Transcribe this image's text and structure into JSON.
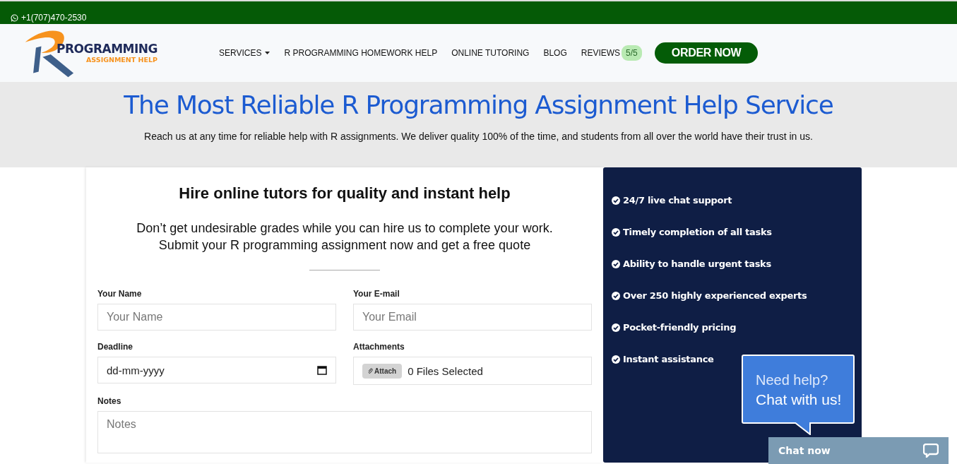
{
  "top_bar": {
    "phone": "+1(707)470-2530"
  },
  "logo": {
    "title": "PROGRAMMING",
    "subtitle": "ASSIGNMENT HELP"
  },
  "nav": {
    "items": [
      {
        "label": "SERVICES",
        "kind": "dropdown"
      },
      {
        "label": "R PROGRAMMING HOMEWORK HELP",
        "kind": "link"
      },
      {
        "label": "ONLINE TUTORING",
        "kind": "link"
      },
      {
        "label": "BLOG",
        "kind": "link"
      },
      {
        "label": "REVIEWS",
        "kind": "link",
        "badge": "5/5"
      }
    ],
    "cta": "ORDER NOW"
  },
  "hero": {
    "title": "The Most Reliable R Programming Assignment Help Service",
    "subtitle": "Reach us at any time for reliable help with R assignments. We deliver quality 100% of the time, and students from all over the world have their trust in us."
  },
  "form": {
    "title": "Hire online tutors for quality and instant help",
    "intro": [
      "Don’t get undesirable grades while you can hire us to complete your work.",
      "Submit your R programming assignment now and get a free quote"
    ],
    "fields": [
      {
        "label": "Your Name",
        "kind": "text",
        "placeholder": "Your Name"
      },
      {
        "label": "Your E-mail",
        "kind": "text",
        "placeholder": "Your Email"
      },
      {
        "label": "Deadline",
        "kind": "date",
        "value": "dd-mm-yyyy"
      },
      {
        "label": "Attachments",
        "kind": "file",
        "button": "Attach",
        "value": "0 Files Selected"
      },
      {
        "label": "Notes",
        "kind": "textarea",
        "placeholder": "Notes"
      }
    ]
  },
  "features": [
    "24/7 live chat support",
    "Timely completion of all tasks",
    "Ability to handle urgent tasks",
    "Over 250 highly experienced experts",
    "Pocket-friendly pricing",
    "Instant assistance"
  ],
  "chat": {
    "bubble": [
      "Need help?",
      "Chat with us!"
    ],
    "bar": "Chat now"
  }
}
